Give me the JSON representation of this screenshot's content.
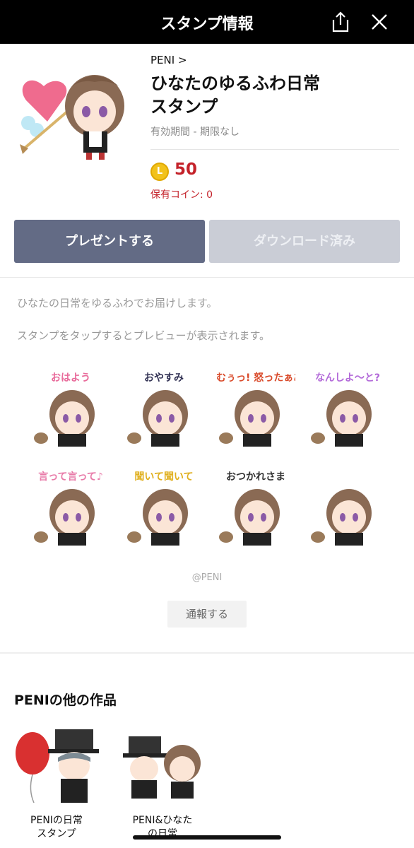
{
  "header": {
    "title": "スタンプ情報",
    "share_icon": "share-icon",
    "close_icon": "close-icon"
  },
  "product": {
    "author": "PENI",
    "author_chevron": ">",
    "title_line1": "ひなたのゆるふわ日常",
    "title_line2": "スタンプ",
    "validity": "有効期間 - 期限なし",
    "coin_letter": "L",
    "price": "50",
    "coins_owned": "保有コイン: 0"
  },
  "actions": {
    "present_label": "プレゼントする",
    "download_label": "ダウンロード済み"
  },
  "description": {
    "line1": "ひなたの日常をゆるふわでお届けします。",
    "line2": "スタンプをタップするとプレビューが表示されます。"
  },
  "stickers": [
    {
      "caption": "おはよう"
    },
    {
      "caption": "おやすみ"
    },
    {
      "caption": "むぅっ! 怒ったぁあ!"
    },
    {
      "caption": "なんしよ～と?"
    },
    {
      "caption": "言って言って♪"
    },
    {
      "caption": "聞いて聞いて"
    },
    {
      "caption": "おつかれさま"
    },
    {
      "caption": ""
    }
  ],
  "footer": {
    "credit": "@PENI",
    "report_label": "通報する"
  },
  "other_works": {
    "title": "PENIの他の作品",
    "items": [
      {
        "line1": "PENIの日常",
        "line2": "スタンプ"
      },
      {
        "line1": "PENI&ひなた",
        "line2": "の日常"
      }
    ]
  },
  "colors": {
    "header_bg": "#000000",
    "present_button": "#636b85",
    "download_button": "#cacdd6",
    "price_red": "#c4222a",
    "coin_gold": "#f2c21b"
  }
}
